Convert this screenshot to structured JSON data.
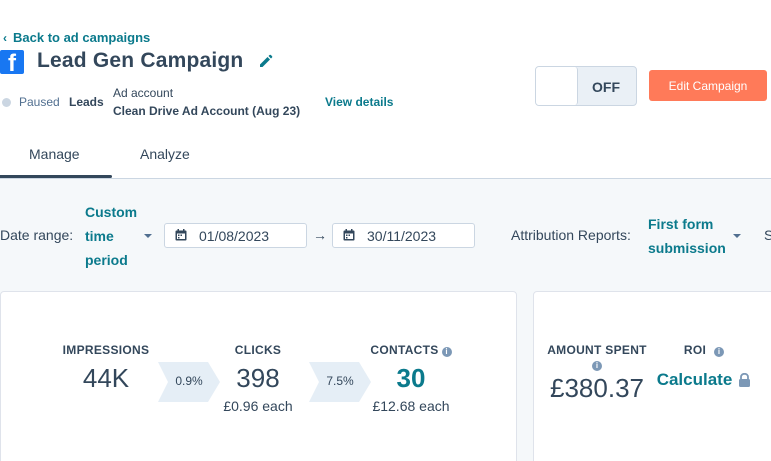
{
  "header": {
    "back_link": "Back to ad campaigns",
    "campaign_title": "Lead Gen Campaign",
    "status": "Paused",
    "objective": "Leads",
    "ad_account_label": "Ad account",
    "ad_account_name": "Clean Drive Ad Account (Aug 23)",
    "view_details": "View details",
    "toggle_state": "OFF",
    "edit_button": "Edit Campaign"
  },
  "tabs": [
    {
      "label": "Manage",
      "active": true
    },
    {
      "label": "Analyze",
      "active": false
    }
  ],
  "filters": {
    "date_range_label": "Date range:",
    "date_range_value": "Custom time period",
    "start_date": "01/08/2023",
    "arrow": "→",
    "end_date": "30/11/2023",
    "attribution_label": "Attribution Reports:",
    "attribution_value": "First form submission",
    "cutoff_text": "S"
  },
  "funnel": {
    "impressions": {
      "label": "IMPRESSIONS",
      "value": "44K"
    },
    "rate_1": "0.9%",
    "clicks": {
      "label": "CLICKS",
      "value": "398",
      "sub": "£0.96 each"
    },
    "rate_2": "7.5%",
    "contacts": {
      "label": "CONTACTS",
      "value": "30",
      "sub": "£12.68 each"
    }
  },
  "spend": {
    "amount_spent": {
      "label": "AMOUNT SPENT",
      "value": "£380.37"
    },
    "roi": {
      "label": "ROI",
      "value": "Calculate"
    }
  },
  "colors": {
    "accent": "#0b7a8c",
    "primary_button": "#ff7a59",
    "text": "#33475b",
    "facebook": "#1877f2"
  },
  "icons": [
    "chevron-left-icon",
    "facebook-icon",
    "pencil-icon",
    "calendar-icon",
    "info-icon",
    "lock-icon",
    "caret-down-icon"
  ]
}
